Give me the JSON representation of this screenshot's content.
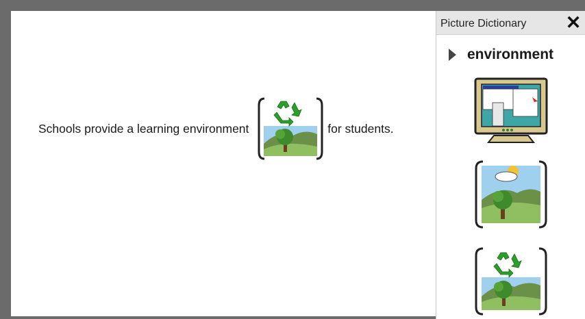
{
  "document": {
    "sentence_before": "Schools provide a learning environment ",
    "sentence_after": "for students.",
    "inline_symbol": "recycle-landscape-icon"
  },
  "panel": {
    "title": "Picture Dictionary",
    "close_label": "✕",
    "word": "environment",
    "images": [
      {
        "icon": "computer-desktop-icon"
      },
      {
        "icon": "landscape-sun-icon"
      },
      {
        "icon": "recycle-landscape-icon"
      }
    ]
  },
  "colors": {
    "sky": "#9fd0ee",
    "hill_light": "#8fbf60",
    "hill_dark": "#6b9048",
    "recycle": "#2aa02a"
  }
}
